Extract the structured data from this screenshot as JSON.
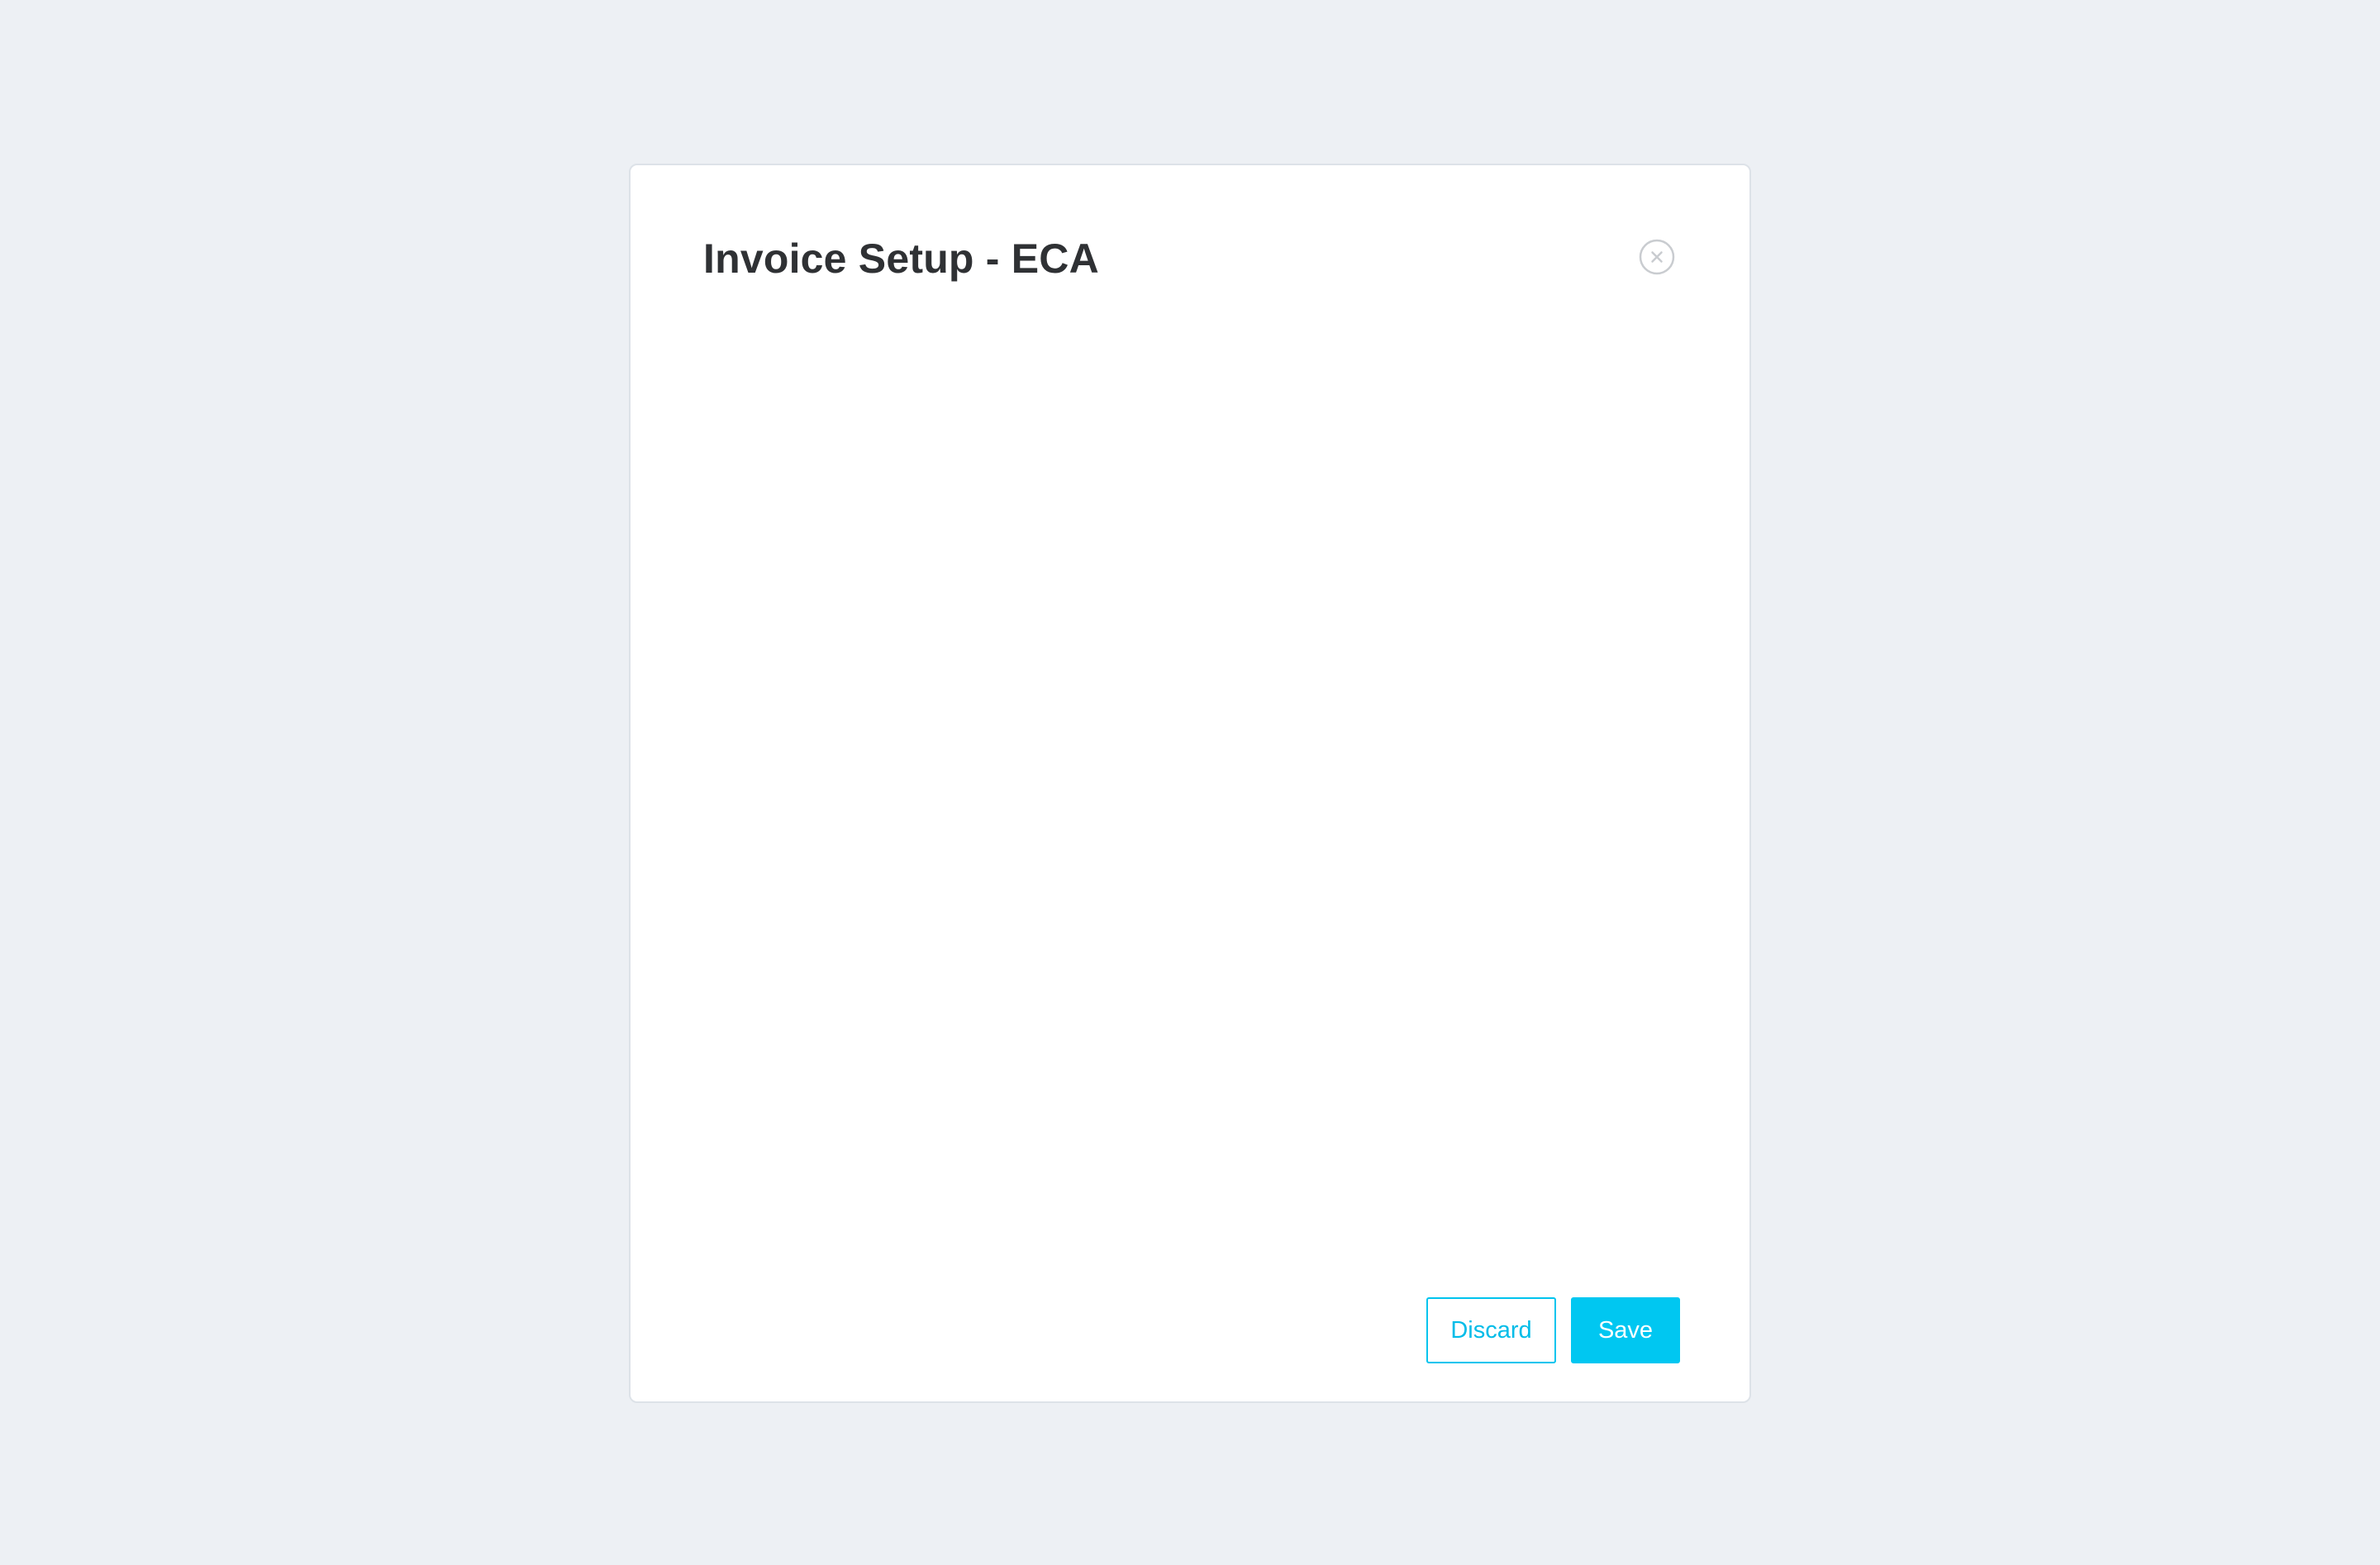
{
  "modal": {
    "title": "Invoice Setup - ECA",
    "close_icon": "close-circle-icon",
    "actions": {
      "discard_label": "Discard",
      "save_label": "Save"
    }
  },
  "colors": {
    "background": "#edf0f4",
    "modal_background": "#ffffff",
    "accent": "#00c7f1",
    "title_text": "#2f3134",
    "close_icon": "#c9ccd0"
  }
}
